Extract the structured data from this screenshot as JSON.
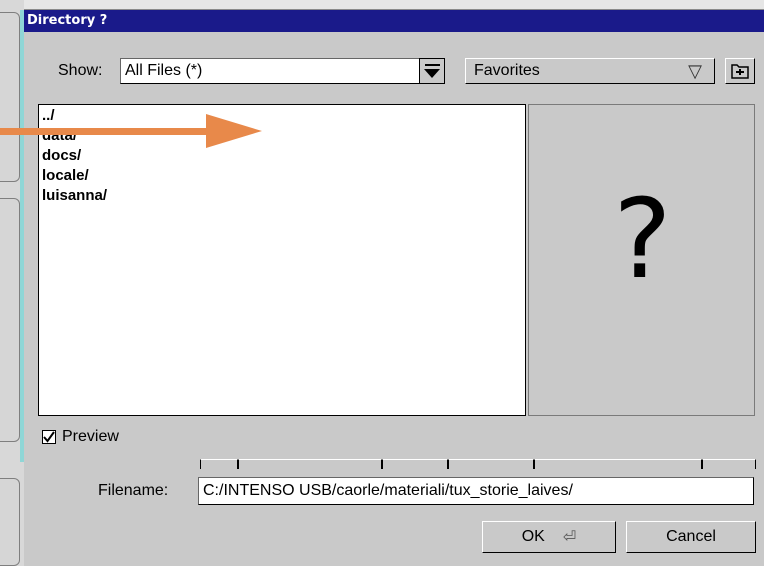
{
  "dialog": {
    "title": "Directory ?",
    "show_label": "Show:",
    "show_value": "All Files (*)",
    "favorites_label": "Favorites",
    "files": [
      "../",
      "data/",
      "docs/",
      "locale/",
      "luisanna/"
    ],
    "preview_label": "Preview",
    "preview_checked": true,
    "preview_placeholder": "?",
    "filename_label": "Filename:",
    "filename_value": "C:/INTENSO USB/caorle/materiali/tux_storie_laives/",
    "ok_label": "OK",
    "cancel_label": "Cancel"
  },
  "icons": {
    "dropdown": "triangle-down-icon",
    "favorites_arrow": "triangle-down-outline-icon",
    "add_favorite": "add-favorite-icon",
    "enter": "enter-key-icon",
    "annotation_arrow": "orange-arrow"
  },
  "colors": {
    "titlebar": "#1a1a8a",
    "annotation_arrow": "#e8894a",
    "accent_rail": "#8fd6d6"
  }
}
